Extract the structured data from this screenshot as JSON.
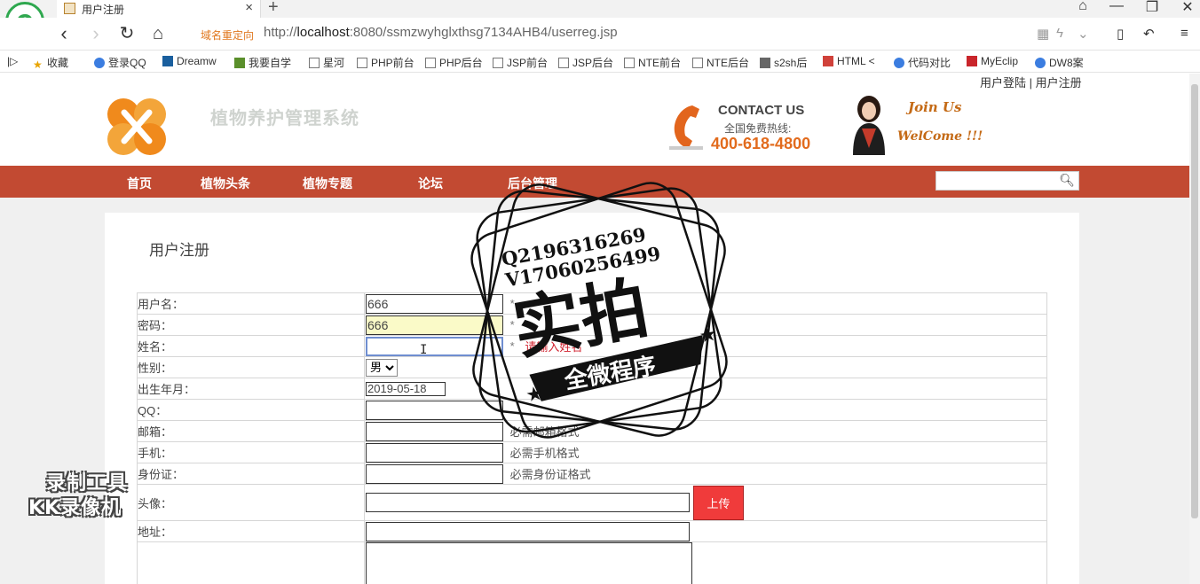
{
  "browser": {
    "tab_title": "用户注册",
    "redirect_label": "域名重定向",
    "url_prefix": "http://",
    "url_host": "localhost",
    "url_rest": ":8080/ssmzwyhglxthsg7134AHB4/userreg.jsp",
    "bookmarks": [
      "收藏",
      "登录QQ",
      "Dreamw",
      "我要自学",
      "星河",
      "PHP前台",
      "PHP后台",
      "JSP前台",
      "JSP后台",
      "NTE前台",
      "NTE后台",
      "s2sh后",
      "HTML",
      "代码对比",
      "MyEclip",
      "DW8案"
    ]
  },
  "header": {
    "top_links": "用户登陆 | 用户注册",
    "site_title": "植物养护管理系统",
    "contact_title": "CONTACT US",
    "contact_sub": "全国免费热线:",
    "contact_number": "400-618-4800",
    "join_title": "Join Us",
    "welcome": "WelCome !!!"
  },
  "nav": {
    "items": [
      "首页",
      "植物头条",
      "植物专题",
      "论坛",
      "后台管理"
    ],
    "search_value": ""
  },
  "content": {
    "title": "用户注册"
  },
  "form": {
    "username_label": "用户名：",
    "username_value": "666",
    "password_label": "密码：",
    "password_value": "666",
    "name_label": "姓名：",
    "name_error": "请输入姓名",
    "gender_label": "性别：",
    "gender_value": "男",
    "birth_label": "出生年月：",
    "birth_value": "2019-05-18",
    "qq_label": "QQ：",
    "email_label": "邮箱：",
    "email_hint": "必需邮箱格式",
    "phone_label": "手机：",
    "phone_hint": "必需手机格式",
    "idcard_label": "身份证：",
    "idcard_hint": "必需身份证格式",
    "avatar_label": "头像：",
    "upload_label": "上传",
    "address_label": "地址：",
    "required_mark": "*"
  },
  "watermark": {
    "line1": "Q2196316269",
    "line2": "V17060256499",
    "big": "实拍",
    "band": "全微程序",
    "kk_line1": "录制工具",
    "kk_line2": "KK录像机"
  }
}
